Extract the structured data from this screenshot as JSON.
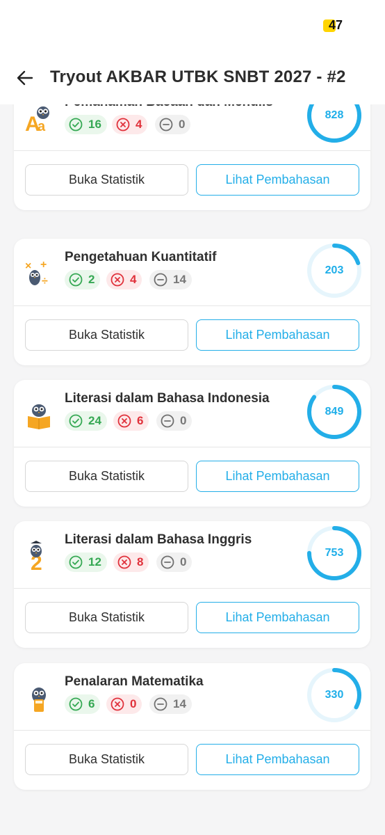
{
  "status_bar": {
    "battery_level": "47"
  },
  "header": {
    "title": "Tryout AKBAR UTBK SNBT 2027 - #2"
  },
  "buttons": {
    "statistics": "Buka Statistik",
    "discussion": "Lihat Pembahasan"
  },
  "colors": {
    "accent": "#23aee8",
    "ring_track": "#e6f5fc",
    "correct": "#35a853",
    "wrong": "#e0313b",
    "empty": "#777777",
    "battery": "#ffd400"
  },
  "subjects": [
    {
      "name": "Pemahaman Bacaan dan Menulis",
      "icon": "owl-letters-icon",
      "correct": "16",
      "wrong": "4",
      "empty": "0",
      "score": "828",
      "score_fraction": 0.83
    },
    {
      "name": "Pengetahuan Kuantitatif",
      "icon": "owl-math-symbols-icon",
      "correct": "2",
      "wrong": "4",
      "empty": "14",
      "score": "203",
      "score_fraction": 0.2
    },
    {
      "name": "Literasi dalam Bahasa Indonesia",
      "icon": "owl-book-icon",
      "correct": "24",
      "wrong": "6",
      "empty": "0",
      "score": "849",
      "score_fraction": 0.85
    },
    {
      "name": "Literasi dalam Bahasa Inggris",
      "icon": "owl-english-icon",
      "correct": "12",
      "wrong": "8",
      "empty": "0",
      "score": "753",
      "score_fraction": 0.75
    },
    {
      "name": "Penalaran Matematika",
      "icon": "owl-calculator-icon",
      "correct": "6",
      "wrong": "0",
      "empty": "14",
      "score": "330",
      "score_fraction": 0.33
    }
  ]
}
